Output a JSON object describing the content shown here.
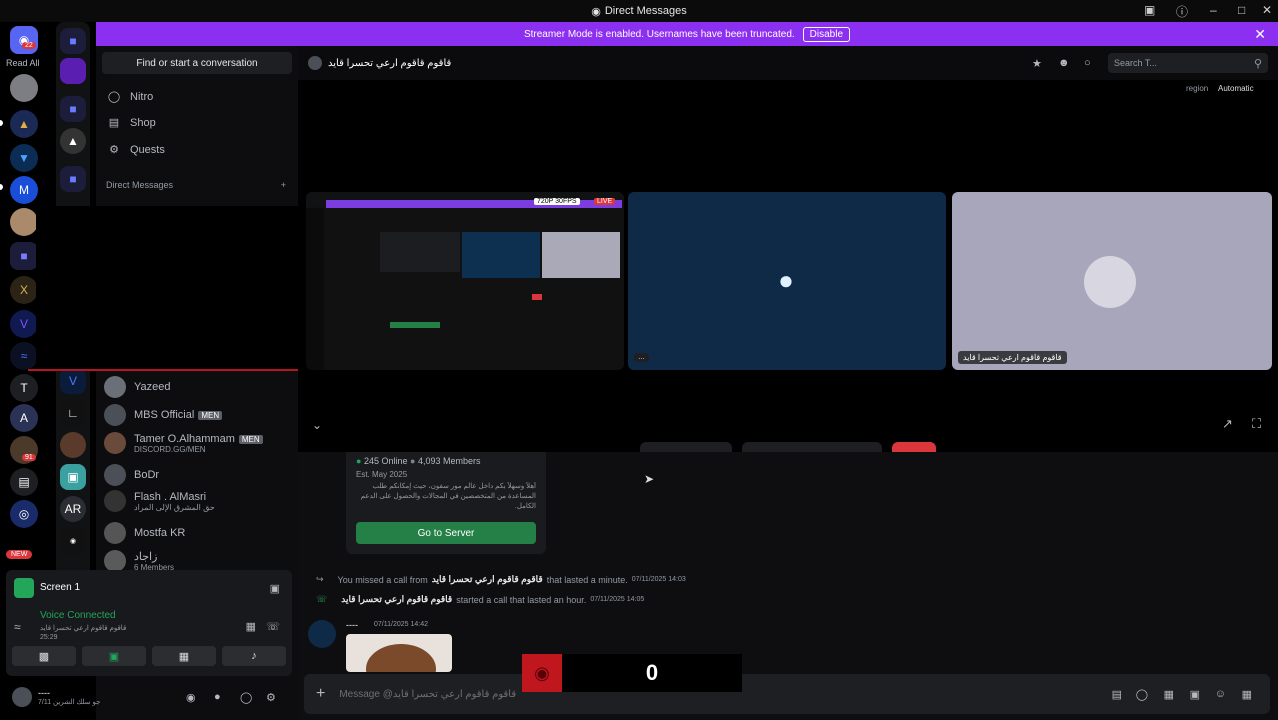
{
  "window": {
    "title": "Direct Messages"
  },
  "banner": {
    "text": "Streamer Mode is enabled. Usernames have been truncated.",
    "button": "Disable"
  },
  "servers": {
    "read_all": "Read All",
    "badge_top": "22",
    "badge_bottom": "NEW",
    "badge_mid": "91",
    "letter_t": "T"
  },
  "sidebar": {
    "search_label": "Find or start a conversation",
    "nav": [
      {
        "label": "Nitro",
        "icon": "nitro-icon"
      },
      {
        "label": "Shop",
        "icon": "shop-icon"
      },
      {
        "label": "Quests",
        "icon": "quests-icon"
      }
    ],
    "dm_header": "Direct Messages",
    "dms": [
      {
        "name": "Yazeed",
        "tag": "",
        "sub": ""
      },
      {
        "name": "MBS Official",
        "tag": "MEN",
        "sub": ""
      },
      {
        "name": "Tamer O.Alhammam",
        "tag": "MEN",
        "sub": "DISCORD.GG/MEN"
      },
      {
        "name": "BoDr",
        "tag": "",
        "sub": ""
      },
      {
        "name": "Flash . AlMasri",
        "tag": "",
        "sub": "حق المشرق الإلى المراد"
      },
      {
        "name": "Mostfa KR",
        "tag": "",
        "sub": ""
      },
      {
        "name": "زاجاد",
        "tag": "",
        "sub": "6 Members"
      }
    ]
  },
  "voice": {
    "screen_label": "Screen 1",
    "status": "Voice Connected",
    "channel": "قاقوم قاقوم ارعي تحسرا قايد",
    "timer": "25:29"
  },
  "user": {
    "name": "----",
    "status": "جو سلك الشرين 7/11"
  },
  "call": {
    "title": "قاقوم قاقوم ارعي تحسرا قايد",
    "search_placeholder": "Search T...",
    "region_label": "region",
    "region_value": "Automatic",
    "stream_badge": "720P 30FPS",
    "live_badge": "LIVE",
    "tile3_name": "قاقوم قاقوم ارعي تحسرا قايد"
  },
  "chat": {
    "online": "245 Online",
    "members": "4,093 Members",
    "established": "Est. May 2025",
    "desc": "أهلاً وسهلاً بكم داخل عالم مور سفون، حيث إمكانكم طلب المساعدة من المتخصصين في المجالات والحصول على الدعم الكامل.",
    "go_button": "Go to Server",
    "missed_prefix": "You missed a call from",
    "missed_name": "قاقوم قاقوم ارعي تحسرا قايد",
    "missed_suffix": "that lasted a minute.",
    "missed_time": "07/11/2025 14:03",
    "started_name": "قاقوم قاقوم ارعي تحسرا قايد",
    "started_text": "started a call that lasted an hour.",
    "started_time": "07/11/2025 14:05",
    "msg_user": "----",
    "msg_time": "07/11/2025 14:42",
    "input_placeholder": "Message @قاقوم قاقوم ارعي تحسرا قايد"
  },
  "overlay": {
    "counter": "0"
  }
}
